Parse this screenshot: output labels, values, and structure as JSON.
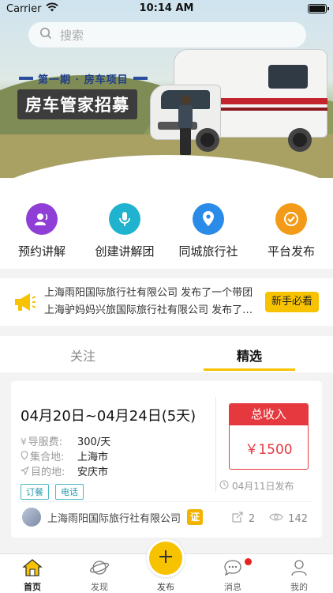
{
  "status_bar": {
    "carrier": "Carrier",
    "time": "10:14 AM"
  },
  "search": {
    "placeholder": "搜索"
  },
  "banner": {
    "series": "第一期 · 房车项目",
    "title": "房车管家招募"
  },
  "quick_actions": [
    {
      "label": "预约讲解",
      "icon": "user-voice-icon",
      "color": "#8f3fd6"
    },
    {
      "label": "创建讲解团",
      "icon": "microphone-icon",
      "color": "#1fb3d0"
    },
    {
      "label": "同城旅行社",
      "icon": "location-pin-icon",
      "color": "#2b8be8"
    },
    {
      "label": "平台发布",
      "icon": "checkmark-icon",
      "color": "#f39a18"
    }
  ],
  "news": {
    "items": [
      "上海雨阳国际旅行社有限公司 发布了一个带团",
      "上海驴妈妈兴旅国际旅行社有限公司 发布了一个"
    ],
    "button": "新手必看"
  },
  "tabs": {
    "follow": "关注",
    "featured": "精选"
  },
  "card": {
    "dates": "04月20日~04月24日(5天)",
    "fee_label": "导服费:",
    "fee_value": "300/天",
    "meet_label": "集合地:",
    "meet_value": "上海市",
    "dest_label": "目的地:",
    "dest_value": "安庆市",
    "tags": [
      "订餐",
      "电话"
    ],
    "income_label": "总收入",
    "income_amount": "￥1500",
    "published": "04月11日发布",
    "agency": "上海雨阳国际旅行社有限公司",
    "cert": "证",
    "shares": "2",
    "views": "142"
  },
  "tabbar": {
    "home": "首页",
    "discover": "发现",
    "publish": "发布",
    "messages": "消息",
    "mine": "我的"
  },
  "colors": {
    "accent": "#f7c200",
    "income": "#e5393f",
    "tag": "#4ab6c5"
  }
}
